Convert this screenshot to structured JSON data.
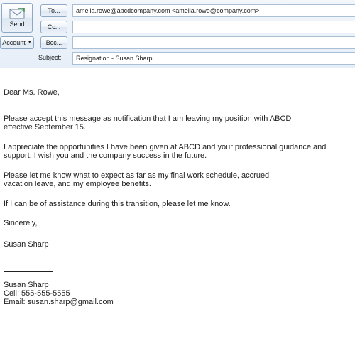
{
  "toolbar": {
    "send_label": "Send",
    "account_label": "Account",
    "to_label": "To...",
    "cc_label": "Cc...",
    "bcc_label": "Bcc...",
    "subject_label": "Subject:"
  },
  "fields": {
    "to_value": "amelia.rowe@abcdcompany.com <amelia.rowe@company.com>",
    "cc_value": "",
    "bcc_value": "",
    "subject_value": "Resignation - Susan Sharp"
  },
  "message": {
    "greeting": "Dear Ms. Rowe,",
    "p1_line1": "Please accept this message as notification that I am leaving my position with ABCD",
    "p1_line2": "effective September 15.",
    "p2_line1": "I appreciate the opportunities I have been given at ABCD and your professional guidance and",
    "p2_line2": "support. I wish you and the company success in the future.",
    "p3_line1": "Please let me know what to expect as far as my final work schedule, accrued",
    "p3_line2": "vacation leave, and my employee benefits.",
    "p4": "If I can be of assistance during this transition, please let me know.",
    "closing": "Sincerely,",
    "sign_name": "Susan Sharp",
    "sig_name": "Susan Sharp",
    "sig_cell": "Cell: 555-555-5555",
    "sig_email": "Email: susan.sharp@gmail.com"
  },
  "icons": {
    "send": "envelope-send-icon",
    "account_caret": "chevron-down-icon"
  }
}
